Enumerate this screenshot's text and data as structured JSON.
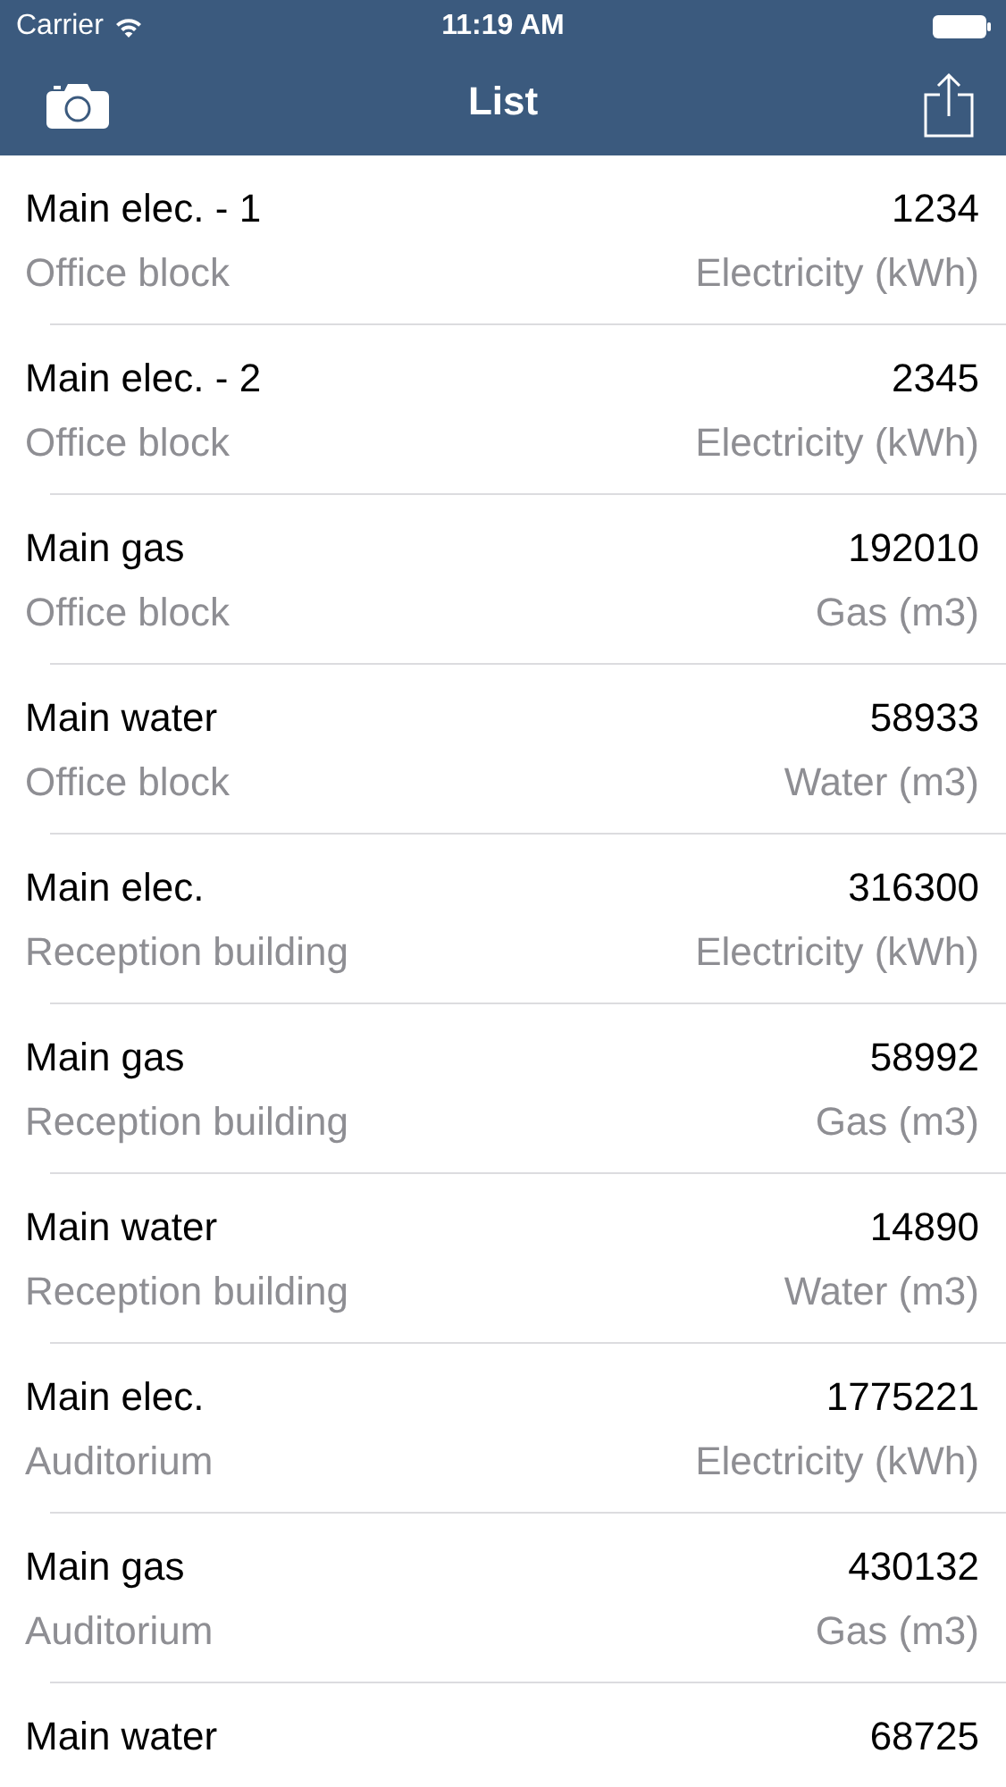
{
  "status_bar": {
    "carrier": "Carrier",
    "time": "11:19 AM"
  },
  "nav_bar": {
    "title": "List"
  },
  "rows": [
    {
      "name": "Main elec. - 1",
      "value": "1234",
      "location": "Office block",
      "unit": "Electricity (kWh)"
    },
    {
      "name": "Main elec. - 2",
      "value": "2345",
      "location": "Office block",
      "unit": "Electricity (kWh)"
    },
    {
      "name": "Main gas",
      "value": "192010",
      "location": "Office block",
      "unit": "Gas (m3)"
    },
    {
      "name": "Main water",
      "value": "58933",
      "location": "Office block",
      "unit": "Water (m3)"
    },
    {
      "name": "Main elec.",
      "value": "316300",
      "location": "Reception building",
      "unit": "Electricity (kWh)"
    },
    {
      "name": "Main gas",
      "value": "58992",
      "location": "Reception building",
      "unit": "Gas (m3)"
    },
    {
      "name": "Main water",
      "value": "14890",
      "location": "Reception building",
      "unit": "Water (m3)"
    },
    {
      "name": "Main elec.",
      "value": "1775221",
      "location": "Auditorium",
      "unit": "Electricity (kWh)"
    },
    {
      "name": "Main gas",
      "value": "430132",
      "location": "Auditorium",
      "unit": "Gas (m3)"
    },
    {
      "name": "Main water",
      "value": "68725"
    }
  ]
}
